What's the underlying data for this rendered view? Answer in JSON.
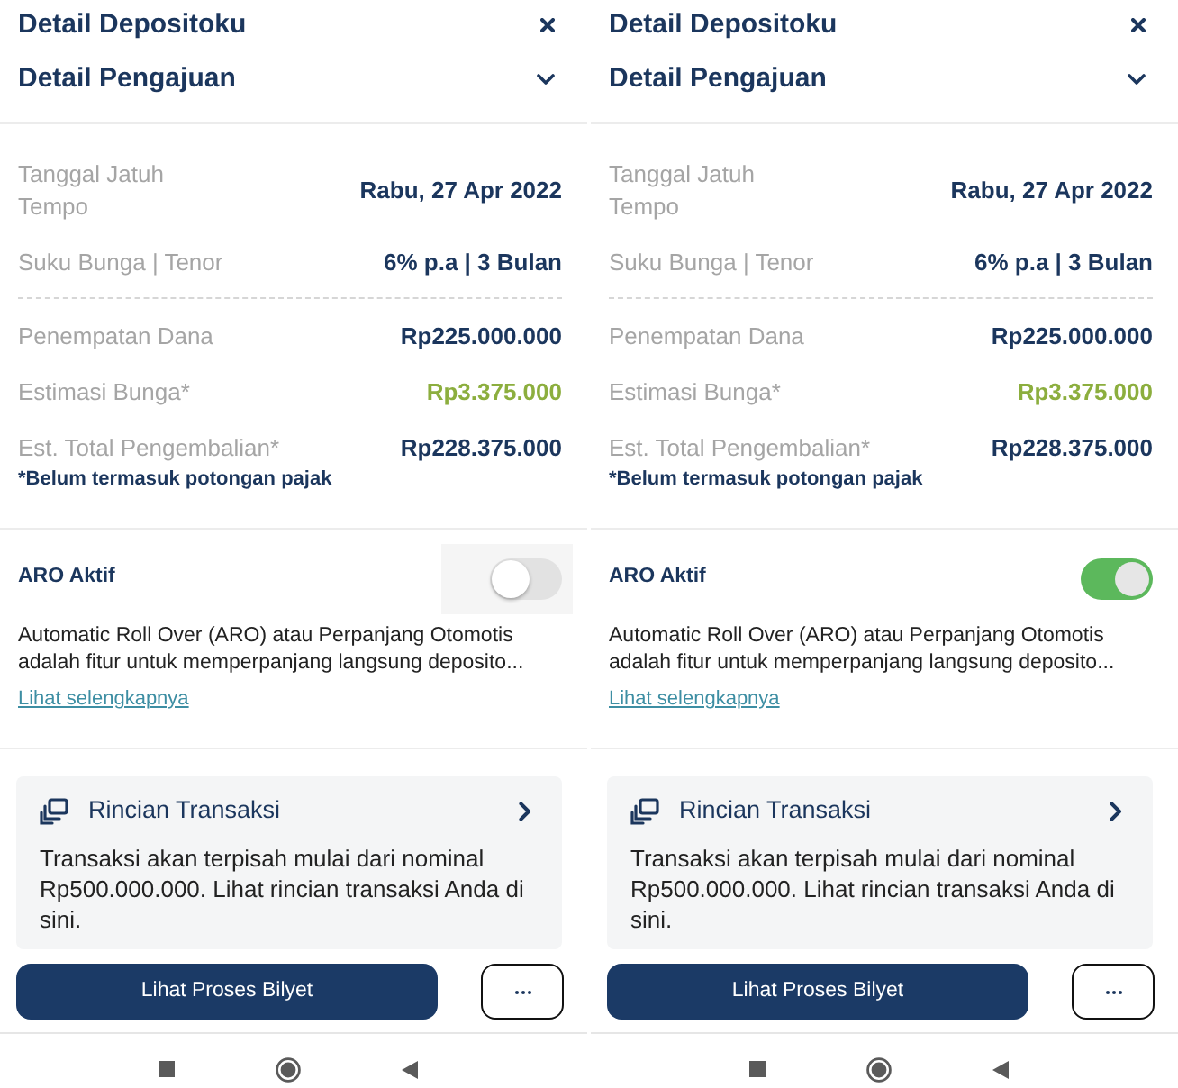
{
  "screens": [
    {
      "header": {
        "title": "Detail Depositoku",
        "section": "Detail Pengajuan"
      },
      "detail_groups": [
        {
          "rows": [
            {
              "label": "Tanggal Jatuh Tempo",
              "value": "Rabu, 27 Apr 2022",
              "kind": "plain"
            },
            {
              "label": "Suku Bunga | Tenor",
              "value": "6% p.a | 3 Bulan",
              "kind": "plain"
            }
          ]
        },
        {
          "rows": [
            {
              "label": "Penempatan Dana",
              "value": "Rp225.000.000",
              "kind": "plain"
            },
            {
              "label": "Estimasi Bunga*",
              "value": "Rp3.375.000",
              "kind": "accent"
            },
            {
              "label": "Est. Total Pengembalian*",
              "value": "Rp228.375.000",
              "kind": "plain"
            }
          ],
          "note": "*Belum termasuk potongan pajak"
        }
      ],
      "aro": {
        "label": "ARO Aktif",
        "on": false,
        "pressed": true,
        "description": "Automatic Roll Over (ARO) atau Perpanjang Otomotis adalah fitur untuk memperpanjang langsung deposito...",
        "link": "Lihat selengkapnya"
      },
      "transaction_card": {
        "title": "Rincian Transaksi",
        "text": "Transaksi akan terpisah mulai dari nominal Rp500.000.000. Lihat rincian transaksi Anda di sini."
      },
      "buttons": {
        "primary": "Lihat Proses Bilyet"
      }
    },
    {
      "header": {
        "title": "Detail Depositoku",
        "section": "Detail Pengajuan"
      },
      "detail_groups": [
        {
          "rows": [
            {
              "label": "Tanggal Jatuh Tempo",
              "value": "Rabu, 27 Apr 2022",
              "kind": "plain"
            },
            {
              "label": "Suku Bunga | Tenor",
              "value": "6% p.a | 3 Bulan",
              "kind": "plain"
            }
          ]
        },
        {
          "rows": [
            {
              "label": "Penempatan Dana",
              "value": "Rp225.000.000",
              "kind": "plain"
            },
            {
              "label": "Estimasi Bunga*",
              "value": "Rp3.375.000",
              "kind": "accent"
            },
            {
              "label": "Est. Total Pengembalian*",
              "value": "Rp228.375.000",
              "kind": "plain"
            }
          ],
          "note": "*Belum termasuk potongan pajak"
        }
      ],
      "aro": {
        "label": "ARO Aktif",
        "on": true,
        "pressed": false,
        "description": "Automatic Roll Over (ARO) atau Perpanjang Otomotis adalah fitur untuk memperpanjang langsung deposito...",
        "link": "Lihat selengkapnya"
      },
      "transaction_card": {
        "title": "Rincian Transaksi",
        "text": "Transaksi akan terpisah mulai dari nominal Rp500.000.000. Lihat rincian transaksi Anda di sini."
      },
      "buttons": {
        "primary": "Lihat Proses Bilyet"
      }
    }
  ]
}
